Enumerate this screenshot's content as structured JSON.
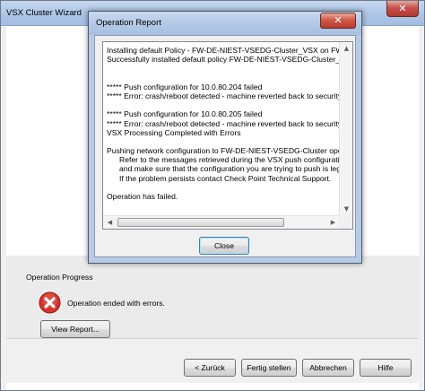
{
  "wizard": {
    "title": "VSX Cluster Wizard",
    "close_glyph": "✕",
    "progress": {
      "group_title": "Operation Progress",
      "status_icon": "error-icon",
      "status_text": "Operation ended with errors.",
      "view_report_label": "View Report..."
    },
    "footer": {
      "back_label": "< Zurück",
      "finish_label": "Fertig stellen",
      "cancel_label": "Abbrechen",
      "help_label": "Hilfe"
    }
  },
  "dialog": {
    "title": "Operation Report",
    "close_glyph": "✕",
    "report_lines": [
      {
        "text": "Installing default Policy - FW-DE-NIEST-VSEDG-Cluster_VSX on FW-D",
        "indent": false
      },
      {
        "text": "Successfully installed default policy FW-DE-NIEST-VSEDG-Cluster_VSX",
        "indent": false
      },
      {
        "text": "",
        "indent": false
      },
      {
        "text": "",
        "indent": false
      },
      {
        "text": "***** Push configuration for 10.0.80.204 failed",
        "indent": false
      },
      {
        "text": "***** Error: crash/reboot detected - machine reverted back to security g",
        "indent": false
      },
      {
        "text": "",
        "indent": false
      },
      {
        "text": "***** Push configuration for 10.0.80.205 failed",
        "indent": false
      },
      {
        "text": "***** Error: crash/reboot detected - machine reverted back to security g",
        "indent": false
      },
      {
        "text": "VSX Processing Completed with Errors",
        "indent": false
      },
      {
        "text": "",
        "indent": false
      },
      {
        "text": "Pushing network configuration to FW-DE-NIEST-VSEDG-Cluster opera",
        "indent": false
      },
      {
        "text": "Refer to the messages retrieved during the VSX push configurati",
        "indent": true
      },
      {
        "text": "and make sure that the configuration you are trying to push is leg",
        "indent": true
      },
      {
        "text": "If the problem persists contact Check Point Technical Support.",
        "indent": true
      },
      {
        "text": "",
        "indent": false
      },
      {
        "text": "Operation has failed.",
        "indent": false
      }
    ],
    "close_label": "Close"
  },
  "colors": {
    "error_red": "#d8322b",
    "title_bar": "#b2c8e6",
    "close_button": "#c75050"
  }
}
